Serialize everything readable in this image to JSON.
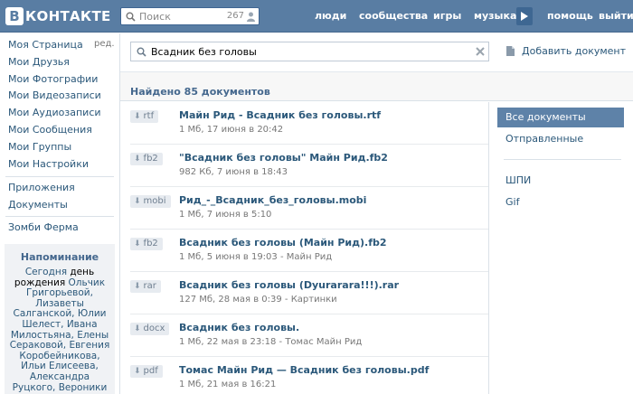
{
  "header": {
    "logo_letter": "В",
    "logo_text": "КОНТАКТЕ",
    "search": {
      "placeholder": "Поиск",
      "count": "267"
    },
    "nav": [
      {
        "label": "люди"
      },
      {
        "label": "сообщества"
      },
      {
        "label": "игры"
      },
      {
        "label": "музыка"
      },
      {
        "label": "помощь"
      },
      {
        "label": "выйти"
      }
    ]
  },
  "left_menu": {
    "items": [
      {
        "label": "Моя Страница"
      },
      {
        "label": "Мои Друзья"
      },
      {
        "label": "Мои Фотографии"
      },
      {
        "label": "Мои Видеозаписи"
      },
      {
        "label": "Мои Аудиозаписи"
      },
      {
        "label": "Мои Сообщения"
      },
      {
        "label": "Мои Группы"
      },
      {
        "label": "Мои Настройки"
      },
      {
        "label": "Приложения"
      },
      {
        "label": "Документы"
      },
      {
        "label": "Зомби Ферма"
      }
    ],
    "edit_label": "ред."
  },
  "reminder": {
    "title": "Напоминание",
    "today": "Сегодня",
    "birthday": "день рождения",
    "names": "Ольчик Григорьевой, Лизаветы Салганской, Юлии Шелест, Ивана Милостьяна, Елены Сераковой, Евгения Коробейникова, Ильи Елисеева, Александра Руцкого, Вероники"
  },
  "doc_search": {
    "value": "Всадник без головы",
    "add_label": "Добавить документ"
  },
  "found_text": "Найдено 85 документов",
  "documents": [
    {
      "ext": "rtf",
      "title": "Майн Рид - Всадник без головы.rtf",
      "meta": "1 Мб, 17 июня в 20:42",
      "tag": ""
    },
    {
      "ext": "fb2",
      "title": "\"Всадник без головы\" Майн Рид.fb2",
      "meta": "982 Кб, 7 июня в 18:43",
      "tag": ""
    },
    {
      "ext": "mobi",
      "title": "Рид_-_Всадник_без_головы.mobi",
      "meta": "1 Мб, 7 июня в 5:10",
      "tag": ""
    },
    {
      "ext": "fb2",
      "title": "Всадник без головы (Майн Рид).fb2",
      "meta": "1 Мб, 5 июня в 19:03",
      "tag": "Майн Рид"
    },
    {
      "ext": "rar",
      "title": "Всадник без головы (Dyurarara!!!).rar",
      "meta": "127 Мб, 28 мая в 0:39",
      "tag": "Картинки"
    },
    {
      "ext": "docx",
      "title": "Всадник без головы.",
      "meta": "1 Мб, 22 мая в 23:18",
      "tag": "Томас Майн Рид"
    },
    {
      "ext": "pdf",
      "title": "Томас Майн Рид — Всадник без головы.pdf",
      "meta": "1 Мб, 21 мая в 16:21",
      "tag": ""
    }
  ],
  "filters": {
    "main": [
      {
        "label": "Все документы",
        "active": true
      },
      {
        "label": "Отправленные",
        "active": false
      }
    ],
    "tags": [
      {
        "label": "ШПИ"
      },
      {
        "label": "Gif"
      }
    ]
  },
  "colors": {
    "header_bg": "#597DA3",
    "link": "#2B587A",
    "active_filter": "#5E82A8"
  }
}
